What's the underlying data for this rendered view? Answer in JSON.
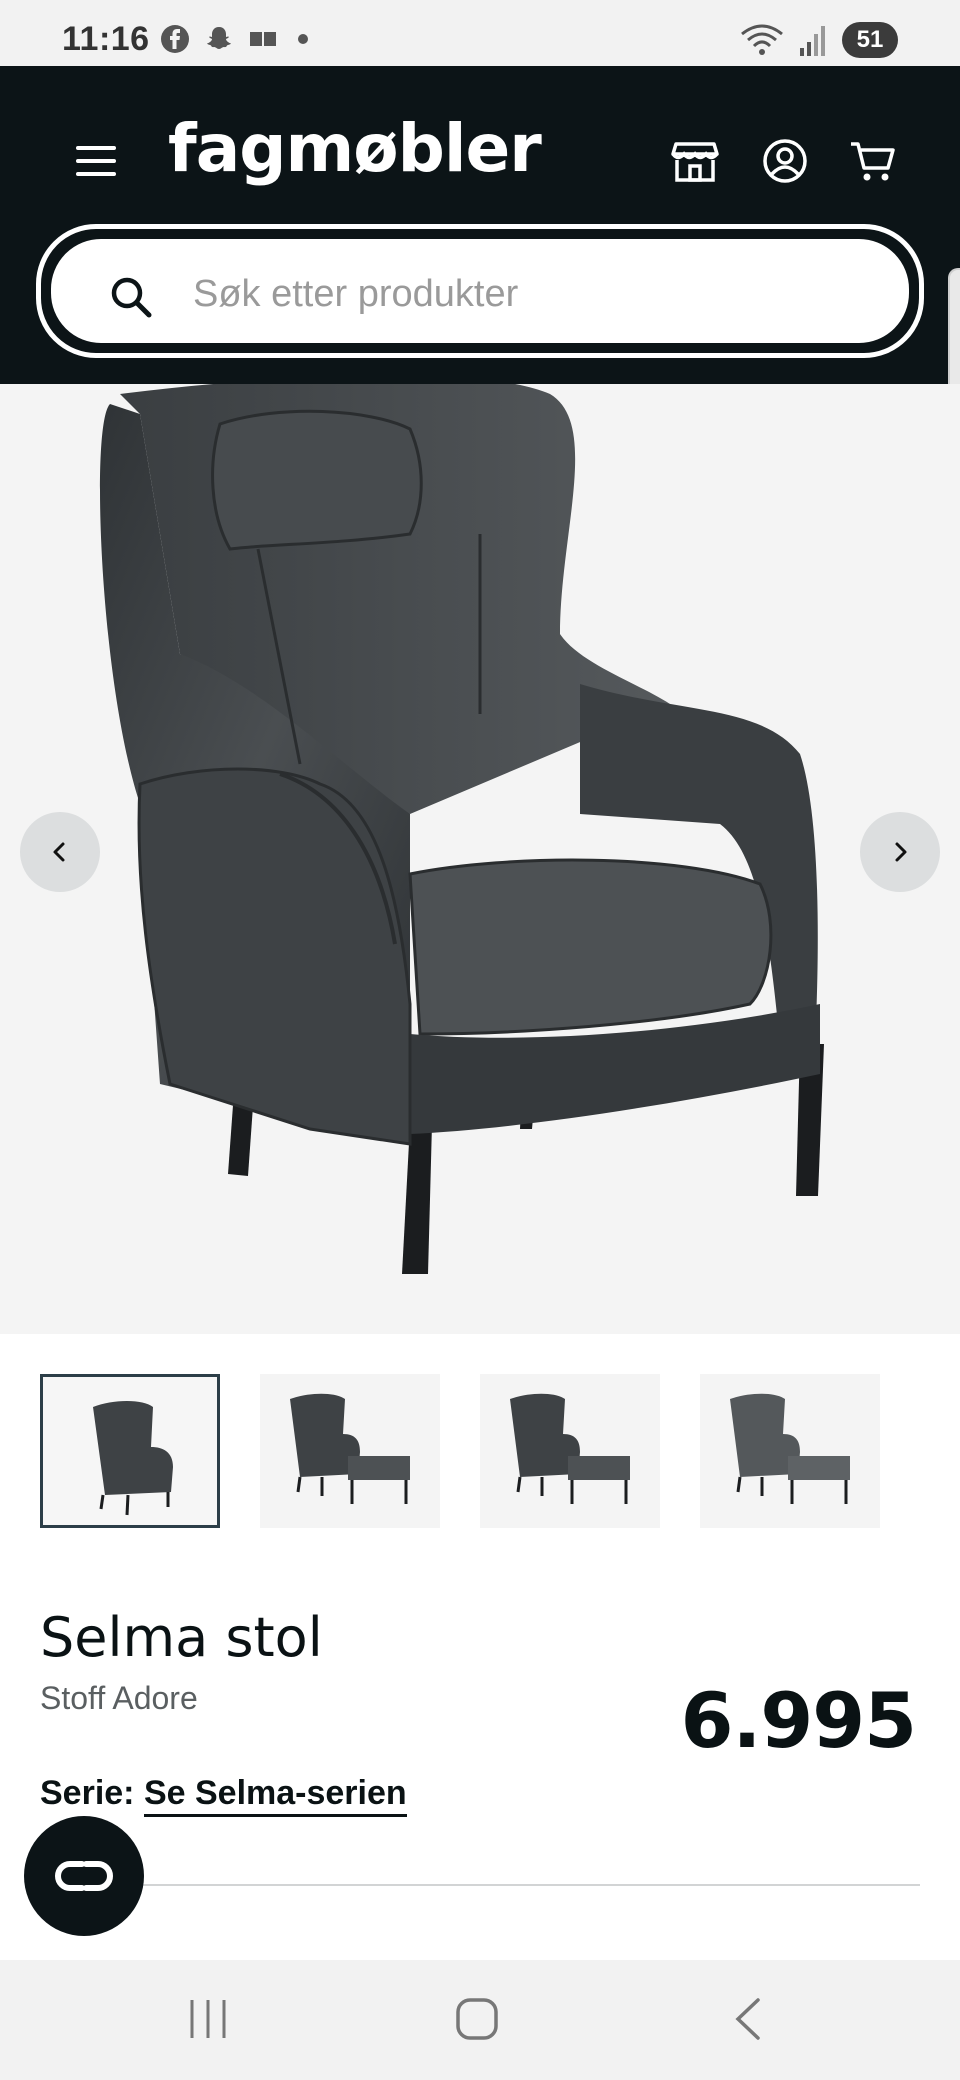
{
  "status_bar": {
    "time": "11:16",
    "battery": "51"
  },
  "header": {
    "logo": "fagmøbler"
  },
  "search": {
    "placeholder": "Søk etter produkter"
  },
  "product": {
    "title": "Selma stol",
    "subtitle": "Stoff Adore",
    "price": "6.995",
    "series_label": "Serie:",
    "series_link": "Se Selma-serien"
  },
  "colors": {
    "header_bg": "#0c1417",
    "gallery_bg": "#f4f4f4",
    "chair": "#3e4245"
  },
  "icons": [
    "menu-icon",
    "store-icon",
    "account-icon",
    "cart-icon",
    "search-icon",
    "chevron-left-icon",
    "chevron-right-icon",
    "chat-icon"
  ]
}
